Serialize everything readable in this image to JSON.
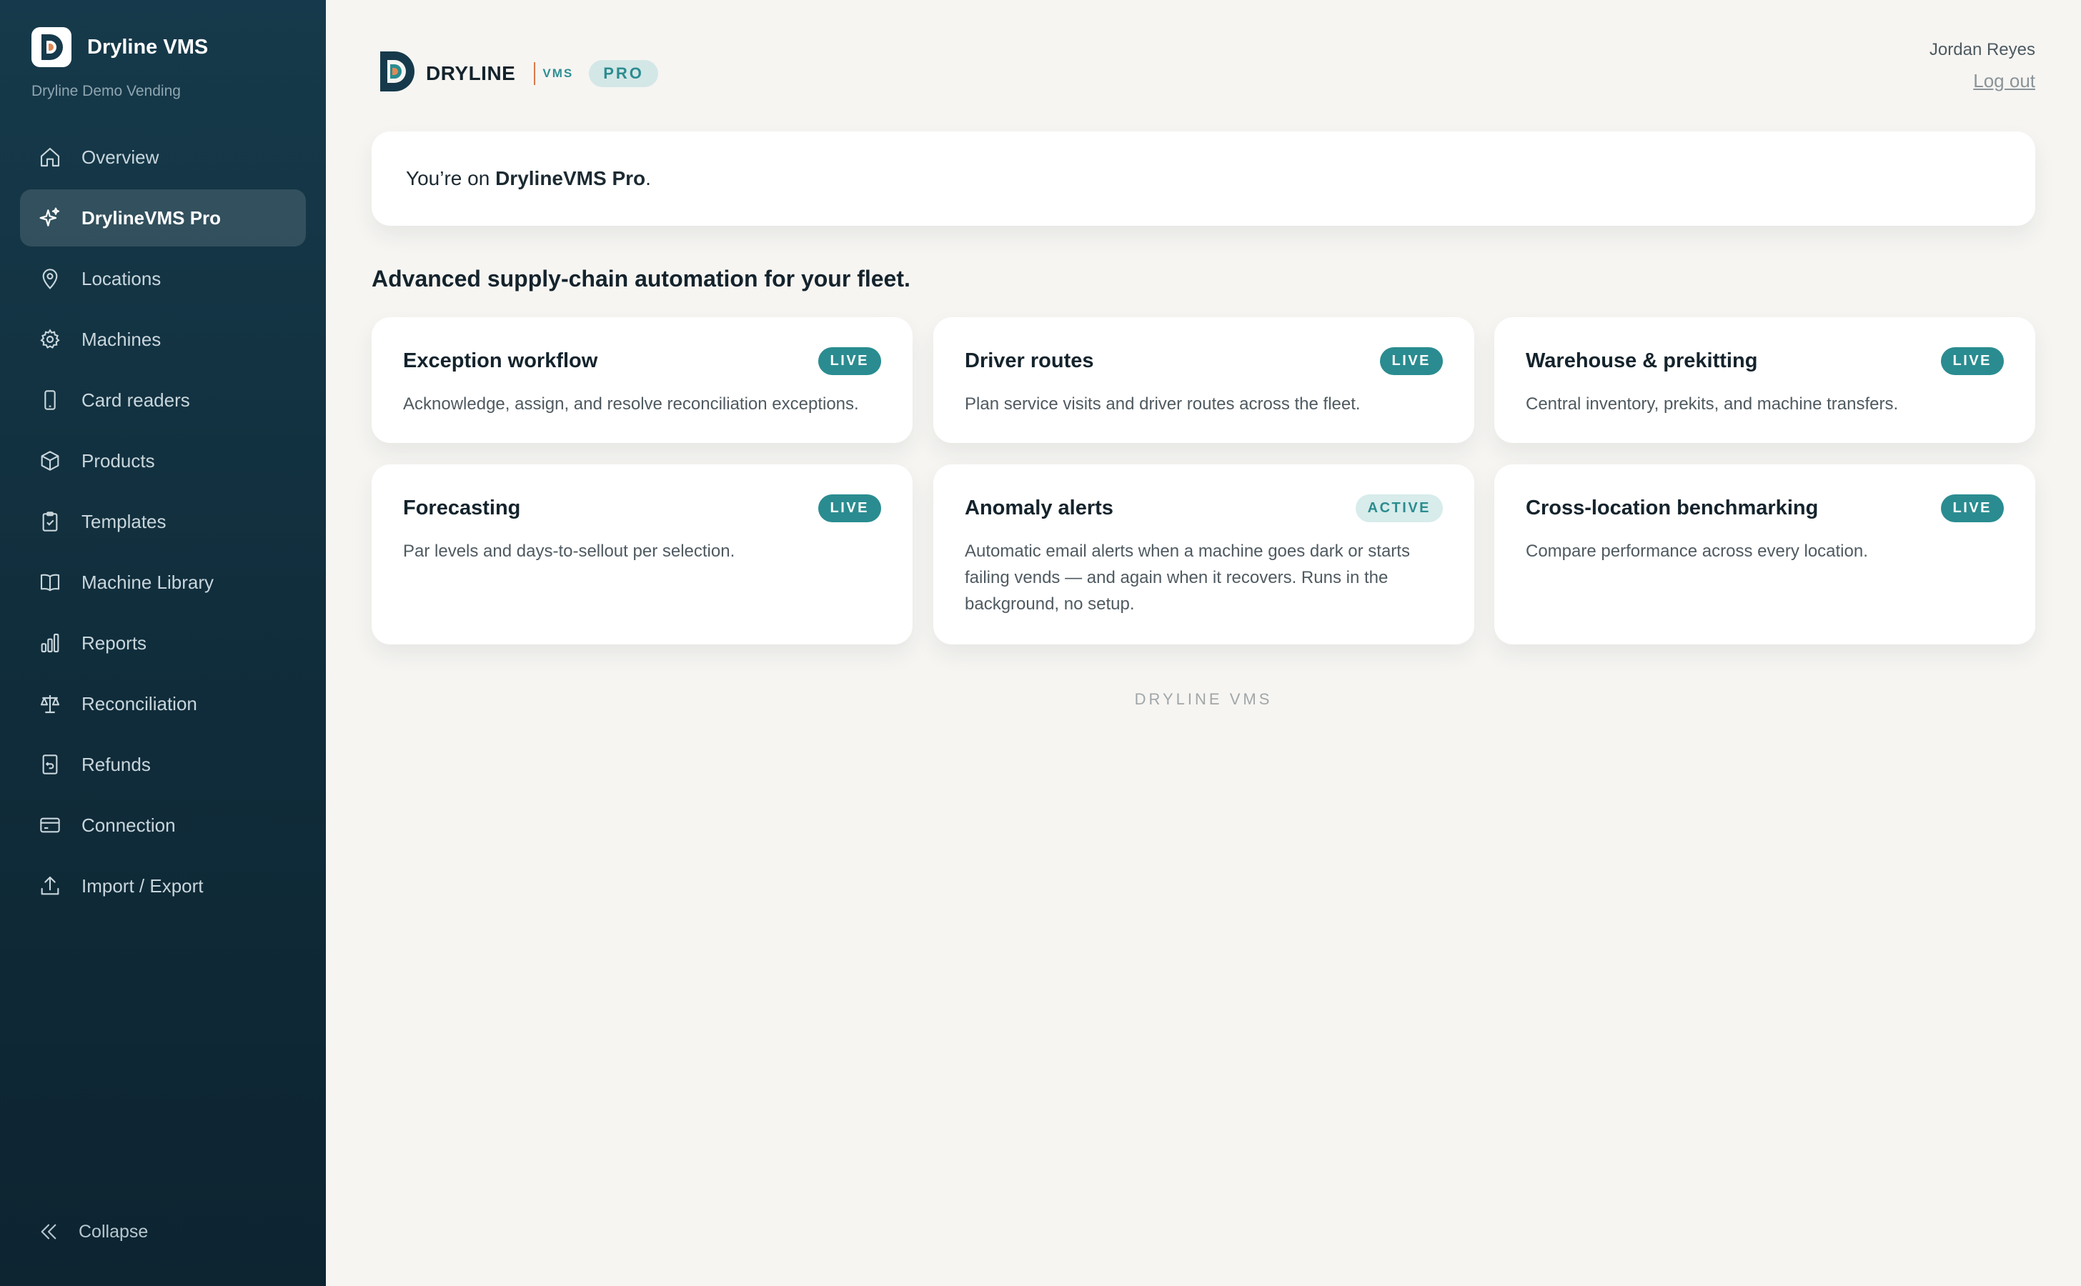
{
  "sidebar": {
    "brand": "Dryline VMS",
    "org": "Dryline Demo Vending",
    "items": [
      {
        "label": "Overview",
        "icon": "home-icon"
      },
      {
        "label": "DrylineVMS Pro",
        "icon": "sparkle-icon",
        "active": true
      },
      {
        "label": "Locations",
        "icon": "map-pin-icon"
      },
      {
        "label": "Machines",
        "icon": "gear-icon"
      },
      {
        "label": "Card readers",
        "icon": "phone-icon"
      },
      {
        "label": "Products",
        "icon": "box-icon"
      },
      {
        "label": "Templates",
        "icon": "clipboard-check-icon"
      },
      {
        "label": "Machine Library",
        "icon": "book-icon"
      },
      {
        "label": "Reports",
        "icon": "bar-chart-icon"
      },
      {
        "label": "Reconciliation",
        "icon": "scale-icon"
      },
      {
        "label": "Refunds",
        "icon": "receipt-refund-icon"
      },
      {
        "label": "Connection",
        "icon": "credit-card-icon"
      },
      {
        "label": "Import / Export",
        "icon": "upload-icon"
      }
    ],
    "collapse_label": "Collapse"
  },
  "header": {
    "logo_word": "DRYLINE",
    "logo_vms": "VMS",
    "pro_pill": "PRO",
    "user_name": "Jordan Reyes",
    "logout_label": "Log out"
  },
  "plan": {
    "prefix": "You’re on ",
    "plan_name": "DrylineVMS Pro",
    "suffix": "."
  },
  "section_title": "Advanced supply-chain automation for your fleet.",
  "features": [
    {
      "title": "Exception workflow",
      "badge": "LIVE",
      "status": "live",
      "desc": "Acknowledge, assign, and resolve reconciliation exceptions."
    },
    {
      "title": "Driver routes",
      "badge": "LIVE",
      "status": "live",
      "desc": "Plan service visits and driver routes across the fleet."
    },
    {
      "title": "Warehouse & prekitting",
      "badge": "LIVE",
      "status": "live",
      "desc": "Central inventory, prekits, and machine transfers."
    },
    {
      "title": "Forecasting",
      "badge": "LIVE",
      "status": "live",
      "desc": "Par levels and days-to-sellout per selection."
    },
    {
      "title": "Anomaly alerts",
      "badge": "ACTIVE",
      "status": "active",
      "desc": "Automatic email alerts when a machine goes dark or starts failing vends — and again when it recovers. Runs in the background, no setup."
    },
    {
      "title": "Cross-location benchmarking",
      "badge": "LIVE",
      "status": "live",
      "desc": "Compare performance across every location."
    }
  ],
  "footer": "DRYLINE VMS",
  "colors": {
    "sidebar": "#163a4b",
    "accent": "#2a8c90",
    "logo_orange": "#d97a4a",
    "background": "#f6f5f2"
  }
}
